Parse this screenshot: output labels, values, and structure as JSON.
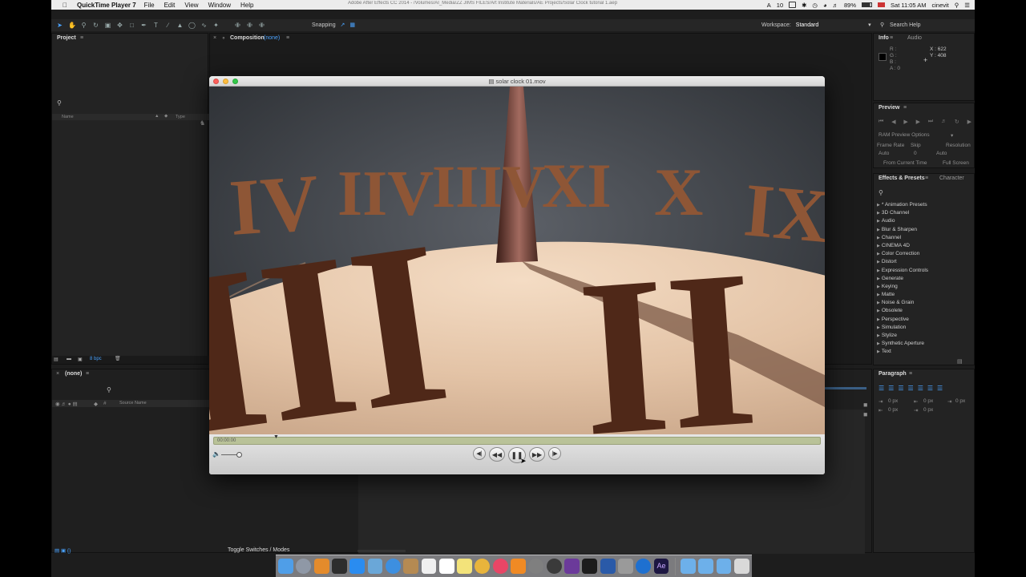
{
  "menubar": {
    "app_name": "QuickTime Player 7",
    "menus": [
      "File",
      "Edit",
      "View",
      "Window",
      "Help"
    ],
    "doc_title": "Adobe After Effects CC 2014 - /Volumes/AI_Media/ZZ JIMS FILES/Art Institute Materials/AE Projects/Solar Clock tutorial 1.aep",
    "battery": "89%",
    "clock": "Sat 11:05 AM",
    "user": "cinevit",
    "adobe_count": "10"
  },
  "ae_toolbar": {
    "snapping_label": "Snapping",
    "workspace_label": "Workspace:",
    "workspace_value": "Standard",
    "search_help": "Search Help"
  },
  "project": {
    "tab": "Project",
    "col_name": "Name",
    "col_type": "Type",
    "bpc": "8 bpc"
  },
  "composition": {
    "tab": "Composition",
    "tab_suffix": "(none)"
  },
  "info": {
    "tab_info": "Info",
    "tab_audio": "Audio",
    "r": "R :",
    "g": "G :",
    "b": "B :",
    "a": "A : 0",
    "x": "X : 622",
    "y": "Y : 408"
  },
  "preview": {
    "tab": "Preview",
    "ram_options": "RAM Preview Options",
    "frame_rate_label": "Frame Rate",
    "skip_label": "Skip",
    "resolution_label": "Resolution",
    "frame_rate_value": "Auto",
    "skip_value": "0",
    "resolution_value": "Auto",
    "from_current": "From Current Time",
    "full_screen": "Full Screen"
  },
  "effects": {
    "tab": "Effects & Presets",
    "tab_character": "Character",
    "items": [
      "* Animation Presets",
      "3D Channel",
      "Audio",
      "Blur & Sharpen",
      "Channel",
      "CINEMA 4D",
      "Color Correction",
      "Distort",
      "Expression Controls",
      "Generate",
      "Keying",
      "Matte",
      "Noise & Grain",
      "Obsolete",
      "Perspective",
      "Simulation",
      "Stylize",
      "Synthetic Aperture",
      "Text"
    ]
  },
  "paragraph": {
    "tab": "Paragraph",
    "indent_left": "0 px",
    "indent_right": "0 px",
    "first_line": "0 px",
    "space_before": "0 px",
    "space_after": "0 px"
  },
  "timeline": {
    "tab": "(none)",
    "source_name": "Source Name",
    "col_hash": "#",
    "toggle": "Toggle Switches / Modes"
  },
  "quicktime": {
    "title": "solar clock 01.mov",
    "timecode": "00:00:00",
    "numerals": [
      "IV",
      "IIV",
      "IIIV",
      "XI",
      "X",
      "IX",
      "III",
      "II"
    ]
  },
  "colors": {
    "accent_blue": "#4aa3ff",
    "numeral_brown": "#5a2e1c",
    "dial_tan": "#e3c3a6"
  }
}
